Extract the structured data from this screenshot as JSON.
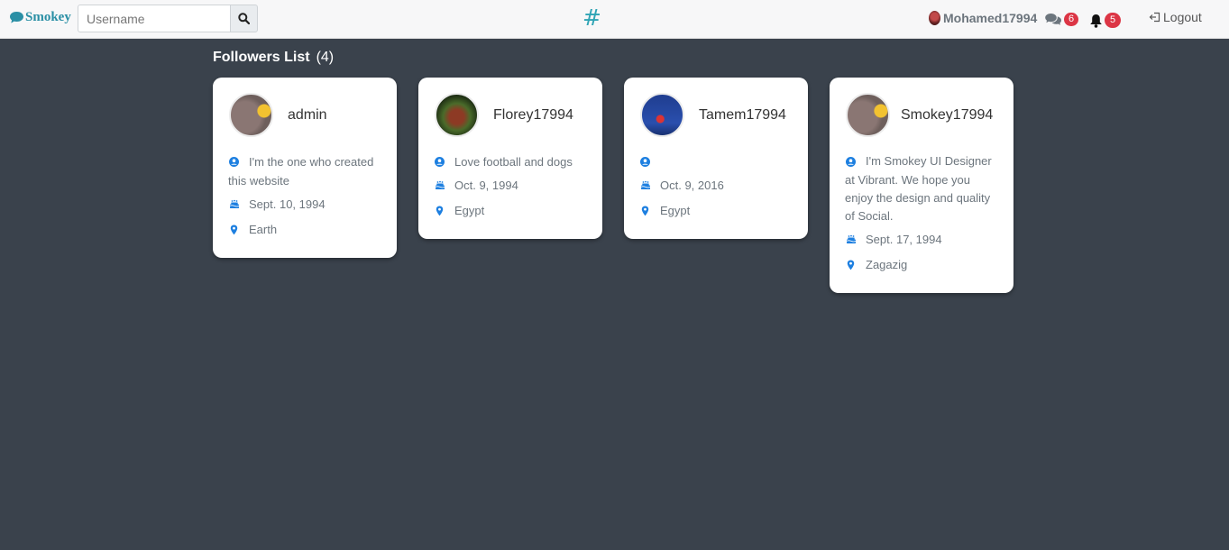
{
  "nav": {
    "brand": "Smokey",
    "search_placeholder": "Username",
    "hash": "#",
    "user_name": "Mohamed17994",
    "messages_count": "6",
    "notifications_count": "5",
    "logout_label": "Logout"
  },
  "section": {
    "title": "Followers List",
    "count": "(4)"
  },
  "followers": [
    {
      "username": "admin",
      "bio": "I'm the one who created this website",
      "birthday": "Sept. 10, 1994",
      "location": "Earth"
    },
    {
      "username": "Florey17994",
      "bio": "Love football and dogs",
      "birthday": "Oct. 9, 1994",
      "location": "Egypt"
    },
    {
      "username": "Tamem17994",
      "bio": "",
      "birthday": "Oct. 9, 2016",
      "location": "Egypt"
    },
    {
      "username": "Smokey17994",
      "bio": "I'm Smokey UI Designer at Vibrant. We hope you enjoy the design and quality of Social.",
      "birthday": "Sept. 17, 1994",
      "location": "Zagazig"
    }
  ],
  "colors": {
    "background": "#3a424c",
    "brand": "#2a8fa5",
    "icon_blue": "#1d7fe0",
    "badge": "#dc3545"
  },
  "icons": [
    "comment-icon",
    "search-icon",
    "comments-icon",
    "bell-icon",
    "logout-icon",
    "user-circle-icon",
    "birthday-cake-icon",
    "map-pin-icon"
  ]
}
